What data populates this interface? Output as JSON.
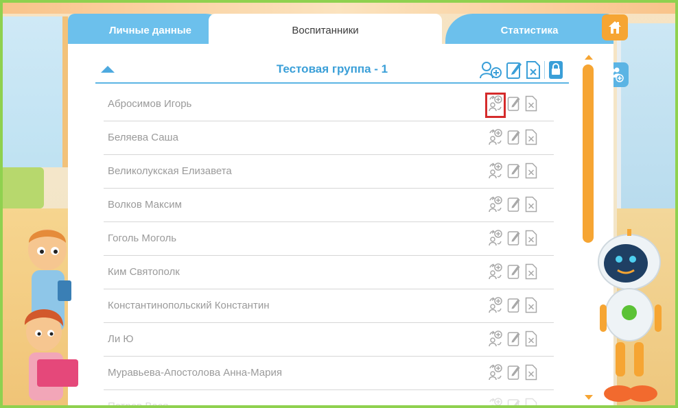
{
  "tabs": {
    "personal": "Личные данные",
    "pupils": "Воспитанники",
    "stats": "Статистика"
  },
  "group": {
    "title": "Тестовая группа - 1"
  },
  "pupils": [
    "Абросимов Игорь",
    "Беляева Саша",
    "Великолукская Елизавета",
    "Волков Максим",
    "Гоголь Моголь",
    "Ким Святополк",
    "Константинопольский Константин",
    "Ли Ю",
    "Муравьева-Апостолова Анна-Мария",
    "Петров Вася"
  ],
  "icons": {
    "home": "home-icon",
    "add_group": "add-group-icon",
    "add_user": "add-user-icon",
    "edit": "edit-icon",
    "delete": "delete-icon",
    "lock": "lock-icon",
    "transfer_user": "transfer-user-icon"
  },
  "colors": {
    "accent_blue": "#5bb4e4",
    "orange": "#f6a533",
    "highlight_red": "#d52b2b"
  }
}
